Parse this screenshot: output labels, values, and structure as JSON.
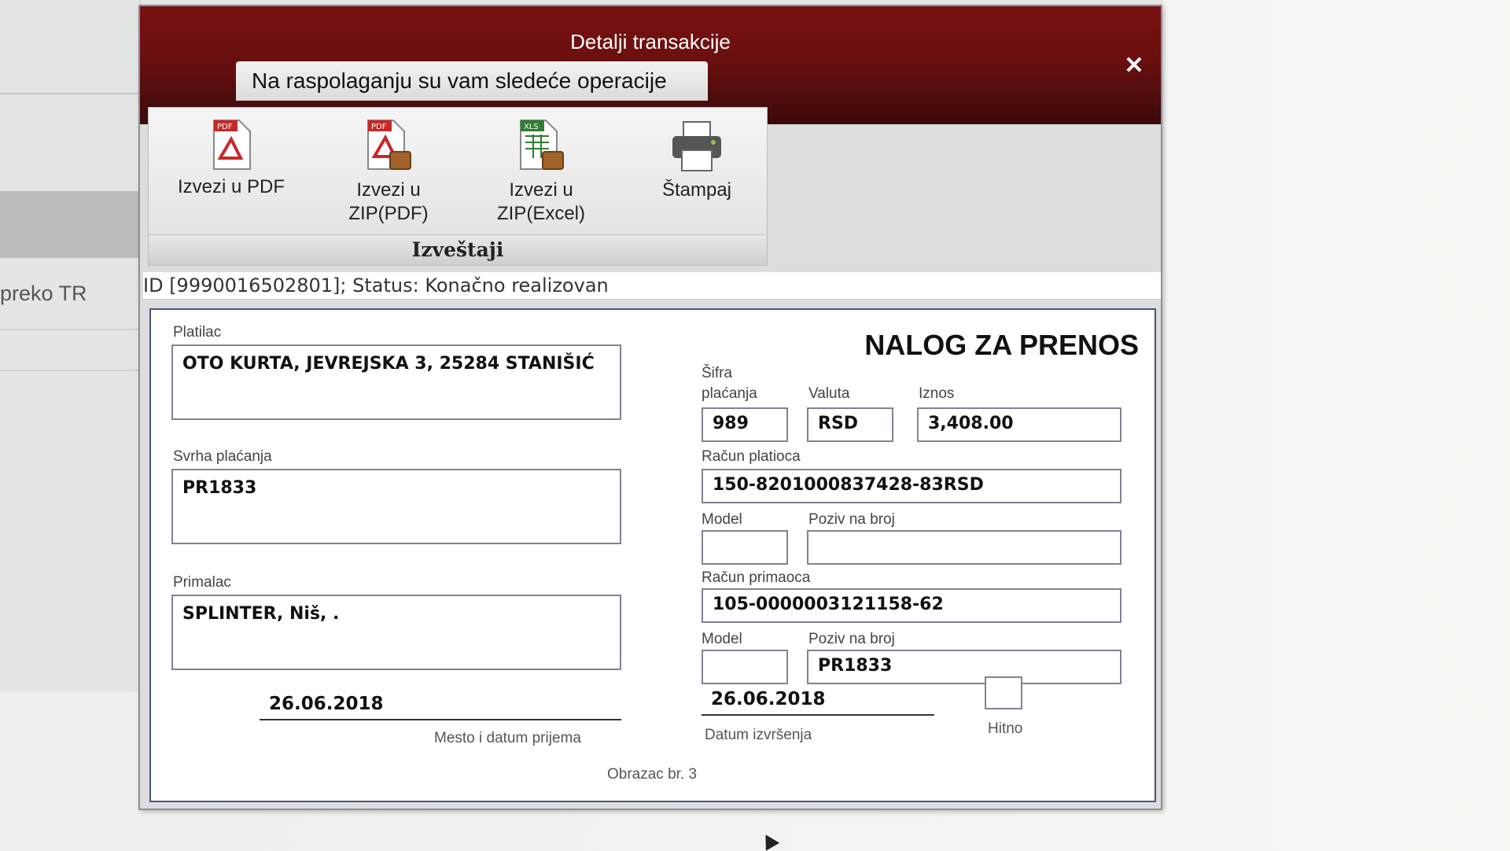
{
  "background": {
    "side_text": "preko TR"
  },
  "dialog": {
    "title": "Detalji transakcije",
    "close_icon": "close-icon",
    "ops_tab": "Na raspolaganju su vam sledeće operacije",
    "toolbar": {
      "items": [
        {
          "label": "Izvezi u PDF",
          "icon": "pdf-icon"
        },
        {
          "label": "Izvezi u\nZIP(PDF)",
          "icon": "zip-pdf-icon"
        },
        {
          "label": "Izvezi u\nZIP(Excel)",
          "icon": "zip-excel-icon"
        },
        {
          "label": "Štampaj",
          "icon": "printer-icon"
        }
      ],
      "group_label": "Izveštaji"
    },
    "status_line": "ID [9990016502801]; Status: Konačno realizovan"
  },
  "form": {
    "title": "NALOG ZA PRENOS",
    "platilac": {
      "label": "Platilac",
      "value": "OTO KURTA, JEVREJSKA 3, 25284 STANIŠIĆ"
    },
    "svrha": {
      "label": "Svrha plaćanja",
      "value": "PR1833"
    },
    "primalac": {
      "label": "Primalac",
      "value": "SPLINTER, Niš, ."
    },
    "sifra": {
      "label": "Šifra\nplaćanja",
      "value": "989"
    },
    "valuta": {
      "label": "Valuta",
      "value": "RSD"
    },
    "iznos": {
      "label": "Iznos",
      "value": "3,408.00"
    },
    "racun_platioca": {
      "label": "Račun platioca",
      "value": "150-8201000837428-83RSD"
    },
    "model1": {
      "label": "Model",
      "value": ""
    },
    "poziv1": {
      "label": "Poziv na broj",
      "value": ""
    },
    "racun_primaoca": {
      "label": "Račun primaoca",
      "value": "105-0000003121158-62"
    },
    "model2": {
      "label": "Model",
      "value": ""
    },
    "poziv2": {
      "label": "Poziv na broj",
      "value": "PR1833"
    },
    "datum_prijema": {
      "value": "26.06.2018",
      "caption": "Mesto i datum prijema"
    },
    "datum_izvrsenja": {
      "value": "26.06.2018",
      "caption": "Datum izvršenja"
    },
    "hitno": {
      "label": "Hitno",
      "checked": false
    },
    "footer": "Obrazac br. 3"
  }
}
